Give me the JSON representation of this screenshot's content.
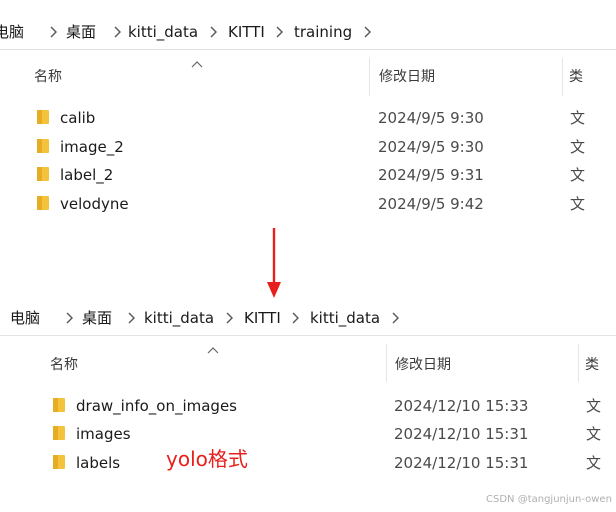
{
  "top_explorer": {
    "breadcrumb": [
      "电脑",
      "桌面",
      "kitti_data",
      "KITTI",
      "training"
    ],
    "columns": {
      "name": "名称",
      "modified": "修改日期",
      "type_partial": "类"
    },
    "rows": [
      {
        "name": "calib",
        "modified": "2024/9/5 9:30",
        "type_partial": "文"
      },
      {
        "name": "image_2",
        "modified": "2024/9/5 9:30",
        "type_partial": "文"
      },
      {
        "name": "label_2",
        "modified": "2024/9/5 9:31",
        "type_partial": "文"
      },
      {
        "name": "velodyne",
        "modified": "2024/9/5 9:42",
        "type_partial": "文"
      }
    ]
  },
  "bottom_explorer": {
    "breadcrumb": [
      "电脑",
      "桌面",
      "kitti_data",
      "KITTI",
      "kitti_data"
    ],
    "columns": {
      "name": "名称",
      "modified": "修改日期",
      "type_partial": "类"
    },
    "rows": [
      {
        "name": "draw_info_on_images",
        "modified": "2024/12/10 15:33",
        "type_partial": "文"
      },
      {
        "name": "images",
        "modified": "2024/12/10 15:31",
        "type_partial": "文"
      },
      {
        "name": "labels",
        "modified": "2024/12/10 15:31",
        "type_partial": "文"
      }
    ]
  },
  "annotation": {
    "text": "yolo格式",
    "color": "#e8201d"
  },
  "arrow_color": "#e8201d",
  "folder_color": "#f4c33c",
  "watermark": "CSDN @tangjunjun-owen"
}
